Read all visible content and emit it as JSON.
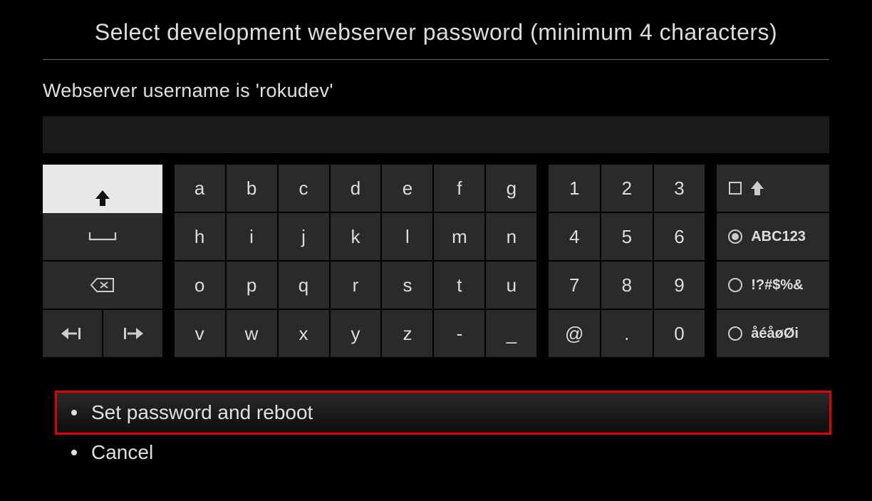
{
  "title": "Select development webserver password (minimum 4 characters)",
  "subtitle": "Webserver username is 'rokudev'",
  "input_value": "",
  "keyboard": {
    "left": {
      "shift": "shift",
      "space": "space",
      "backspace": "backspace",
      "cursor_left": "cursor-left",
      "cursor_right": "cursor-right"
    },
    "letters": [
      [
        "a",
        "b",
        "c",
        "d",
        "e",
        "f",
        "g"
      ],
      [
        "h",
        "i",
        "j",
        "k",
        "l",
        "m",
        "n"
      ],
      [
        "o",
        "p",
        "q",
        "r",
        "s",
        "t",
        "u"
      ],
      [
        "v",
        "w",
        "x",
        "y",
        "z",
        "-",
        "_"
      ]
    ],
    "numbers": [
      [
        "1",
        "2",
        "3"
      ],
      [
        "4",
        "5",
        "6"
      ],
      [
        "7",
        "8",
        "9"
      ],
      [
        "@",
        ".",
        "0"
      ]
    ],
    "modes": {
      "caps_shift": "caps",
      "abc": "ABC123",
      "symbols": "!?#$%&",
      "accents": "åéåøØi"
    }
  },
  "actions": {
    "set_password": "Set password and reboot",
    "cancel": "Cancel"
  }
}
